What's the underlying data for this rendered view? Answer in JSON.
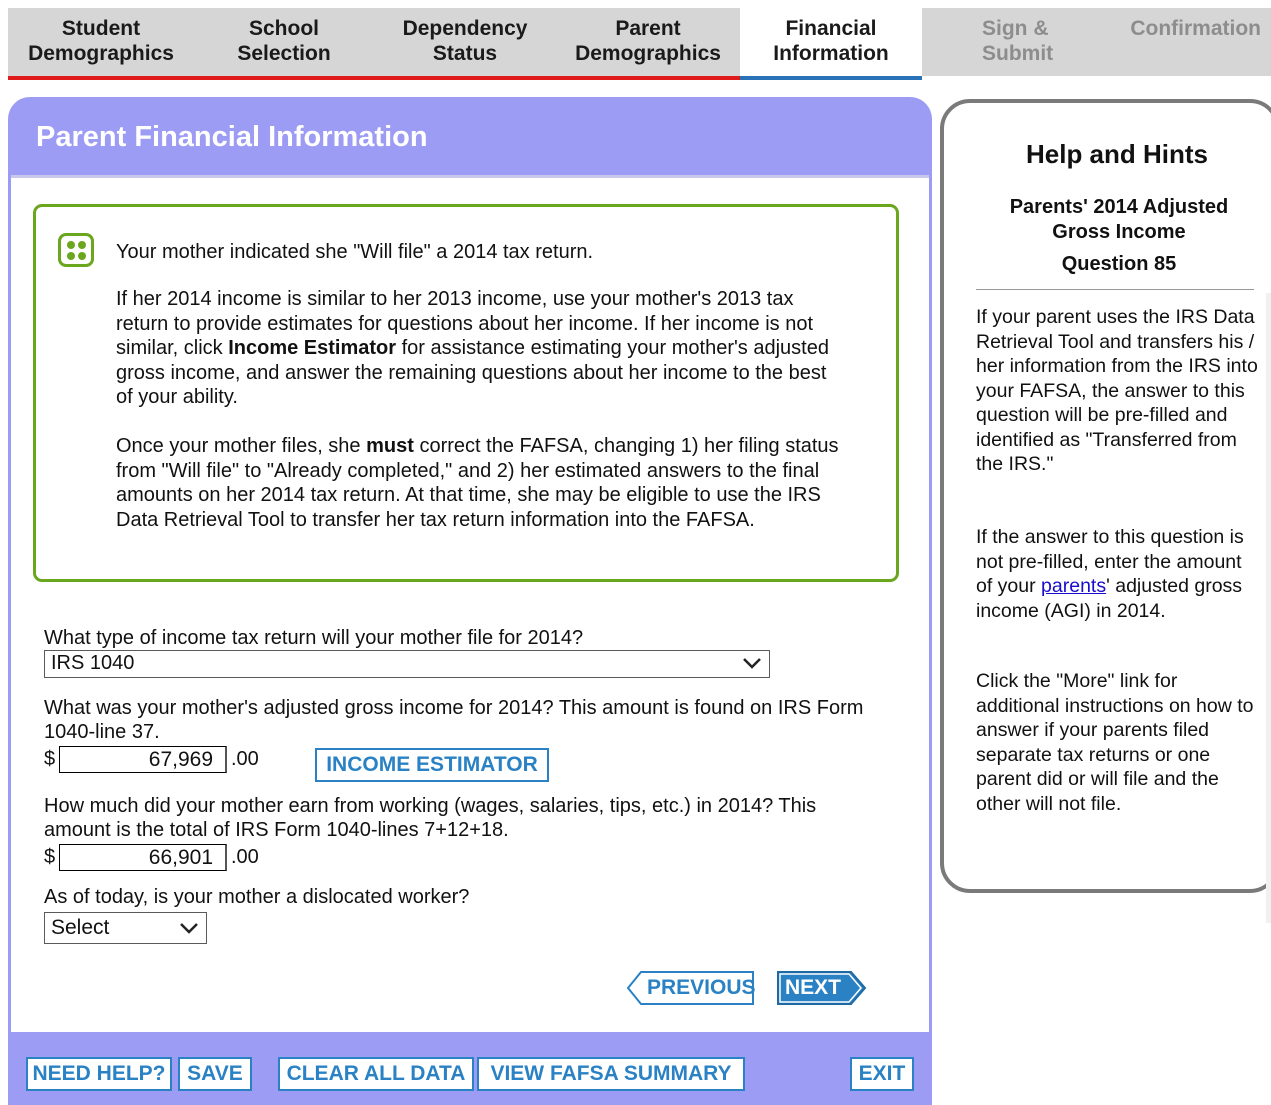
{
  "tabs": [
    {
      "line1": "Student",
      "line2": "Demographics",
      "state": "done"
    },
    {
      "line1": "School",
      "line2": "Selection",
      "state": "done"
    },
    {
      "line1": "Dependency",
      "line2": "Status",
      "state": "done"
    },
    {
      "line1": "Parent",
      "line2": "Demographics",
      "state": "done"
    },
    {
      "line1": "Financial",
      "line2": "Information",
      "state": "active"
    },
    {
      "line1": "Sign &",
      "line2": "Submit",
      "state": "future"
    },
    {
      "line1": "Confirmation",
      "line2": "",
      "state": "future"
    }
  ],
  "panel": {
    "title": "Parent Financial Information",
    "notice": {
      "line1": "Your mother indicated she \"Will file\" a 2014 tax return.",
      "para2_pre": "If her 2014 income is similar to her 2013 income, use your mother's 2013 tax return to provide estimates for questions about her income. If her income is not similar, click ",
      "para2_bold": "Income Estimator",
      "para2_post": " for assistance estimating your mother's adjusted gross income, and answer the remaining questions about her income to the best of your ability.",
      "para3_pre": "Once your mother files, she ",
      "para3_bold": "must",
      "para3_post": " correct the FAFSA, changing 1) her filing status from \"Will file\" to \"Already completed,\" and 2) her estimated answers to the final amounts on her 2014 tax return. At that time, she may be eligible to use the IRS Data Retrieval Tool to transfer her tax return information into the FAFSA."
    },
    "q1": {
      "label": "What type of income tax return will your mother file for 2014?",
      "value": "IRS 1040"
    },
    "q2": {
      "label": "What was your mother's adjusted gross income for 2014? This amount is found on IRS Form 1040-line 37.",
      "dollar": "$",
      "value": "67,969",
      "cents": ".00",
      "estimator_label": "INCOME ESTIMATOR"
    },
    "q3": {
      "label": "How much did your mother earn from working (wages, salaries, tips, etc.) in 2014? This amount is the total of IRS Form 1040-lines 7+12+18.",
      "dollar": "$",
      "value": "66,901",
      "cents": ".00"
    },
    "q4": {
      "label": "As of today, is your mother a dislocated worker?",
      "value": "Select"
    },
    "prev_label": "PREVIOUS",
    "next_label": "NEXT"
  },
  "footer": {
    "need_help": "NEED HELP?",
    "save": "SAVE",
    "clear": "CLEAR ALL DATA",
    "summary": "VIEW FAFSA SUMMARY",
    "exit": "EXIT"
  },
  "help": {
    "title": "Help and Hints",
    "subtitle": "Parents' 2014 Adjusted Gross Income",
    "question": "Question 85",
    "p1": "If your parent uses the IRS Data Retrieval Tool and transfers his / her information from the IRS into your FAFSA, the answer to this question will be pre-filled and identified as \"Transferred from the IRS.\"",
    "p2_pre": "If the answer to this question is not pre-filled, enter the amount of your ",
    "p2_link": "parents",
    "p2_post": "' adjusted gross income (AGI) in 2014.",
    "p3": "Click the \"More\" link for additional instructions on how to answer if your parents filed separate tax returns or one parent did or will file and the other will not file."
  },
  "colors": {
    "panel": "#9d9cf4",
    "accent_blue": "#2a82c4",
    "notice_green": "#6aa61e",
    "done_underline": "#e01a1a",
    "active_underline": "#2a72b8"
  }
}
